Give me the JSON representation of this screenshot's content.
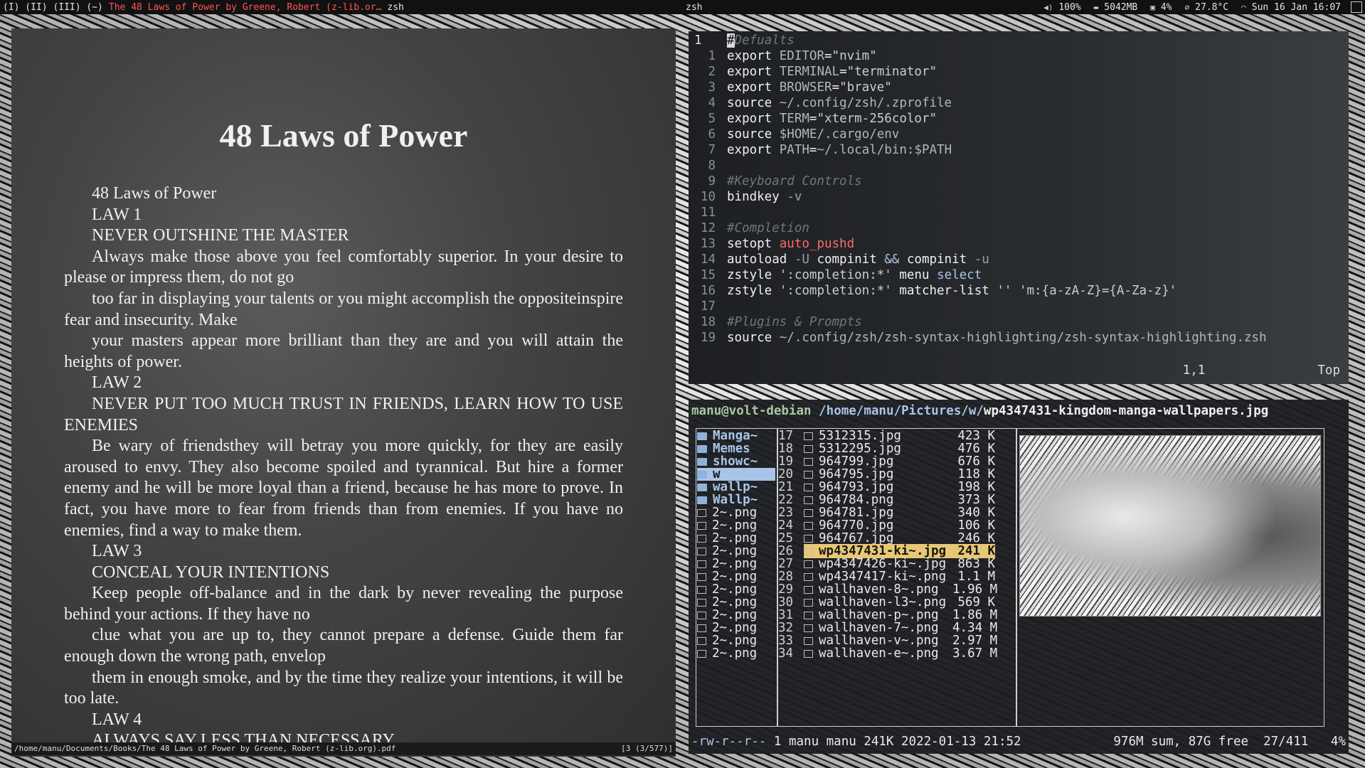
{
  "topbar": {
    "workspaces": "(I) (II) (III) (~)",
    "window_title": "The 48 Laws of Power by Greene, Robert (z-lib.or…",
    "window_class": "zsh",
    "center_title": "zsh",
    "volume": "100%",
    "memory": "5042MB",
    "cpu": "4%",
    "temperature": "27.8°C",
    "datetime": "Sun 16 Jan 16:07",
    "icons": [
      "volume-icon",
      "memory-icon",
      "cpu-icon",
      "temperature-icon",
      "wifi-icon",
      "tray-icon"
    ]
  },
  "pdf": {
    "title": "48 Laws of Power",
    "paragraphs": [
      "48 Laws of Power",
      "LAW 1",
      "NEVER OUTSHINE THE MASTER",
      "Always make those above you feel comfortably superior. In your desire to please or impress them, do not go",
      "too far in displaying your talents or you might accomplish the oppositeinspire fear and insecurity. Make",
      "your masters appear more brilliant than they are and you will attain the heights of power.",
      "LAW 2",
      "NEVER PUT TOO MUCH TRUST IN FRIENDS, LEARN HOW TO USE ENEMIES",
      "Be wary of friendsthey will betray you more quickly, for they are easily aroused to envy. They also become spoiled and tyrannical. But hire a former enemy and he will be more loyal than a friend, because he has more to prove. In fact, you have more to fear from friends than from enemies. If you have no enemies, find a way to make them.",
      "LAW 3",
      "CONCEAL YOUR INTENTIONS",
      "Keep people off-balance and in the dark by never revealing the purpose behind your actions. If they have no",
      "clue what you are up to, they cannot prepare a defense. Guide them far enough down the wrong path, envelop",
      "them in enough smoke, and by the time they realize your intentions, it will be too late.",
      "LAW 4",
      "ALWAYS SAY LESS THAN NECESSARY"
    ],
    "status_path": "/home/manu/Documents/Books/The 48 Laws of Power by Greene, Robert (z-lib.org).pdf",
    "status_page": "[3 (3/577)]"
  },
  "nvim": {
    "lines": [
      {
        "n": "1",
        "segs": [
          [
            "cursor",
            "#"
          ],
          [
            "c-cmt",
            "Defualts"
          ]
        ],
        "current": true
      },
      {
        "n": "1",
        "segs": [
          [
            "c-kw",
            "export "
          ],
          [
            "c-var",
            "EDITOR"
          ],
          [
            "c-kw",
            "="
          ],
          [
            "c-str",
            "\"nvim\""
          ]
        ]
      },
      {
        "n": "2",
        "segs": [
          [
            "c-kw",
            "export "
          ],
          [
            "c-var",
            "TERMINAL"
          ],
          [
            "c-kw",
            "="
          ],
          [
            "c-str",
            "\"terminator\""
          ]
        ]
      },
      {
        "n": "3",
        "segs": [
          [
            "c-kw",
            "export "
          ],
          [
            "c-var",
            "BROWSER"
          ],
          [
            "c-kw",
            "="
          ],
          [
            "c-str",
            "\"brave\""
          ]
        ]
      },
      {
        "n": "4",
        "segs": [
          [
            "c-kw",
            "source "
          ],
          [
            "c-var",
            "~/.config/zsh/.zprofile"
          ]
        ]
      },
      {
        "n": "5",
        "segs": [
          [
            "c-kw",
            "export "
          ],
          [
            "c-var",
            "TERM"
          ],
          [
            "c-kw",
            "="
          ],
          [
            "c-str",
            "\"xterm-256color\""
          ]
        ]
      },
      {
        "n": "6",
        "segs": [
          [
            "c-kw",
            "source "
          ],
          [
            "c-var",
            "$HOME"
          ],
          [
            "c-var",
            "/.cargo/env"
          ]
        ]
      },
      {
        "n": "7",
        "segs": [
          [
            "c-kw",
            "export "
          ],
          [
            "c-var",
            "PATH"
          ],
          [
            "c-kw",
            "="
          ],
          [
            "c-var",
            "~/.local/bin:"
          ],
          [
            "c-var",
            "$PATH"
          ]
        ]
      },
      {
        "n": "8",
        "segs": []
      },
      {
        "n": "9",
        "segs": [
          [
            "c-cmt",
            "#Keyboard Controls"
          ]
        ]
      },
      {
        "n": "10",
        "segs": [
          [
            "c-kw",
            "bindkey "
          ],
          [
            "c-flag",
            "-v"
          ]
        ]
      },
      {
        "n": "11",
        "segs": []
      },
      {
        "n": "12",
        "segs": [
          [
            "c-cmt",
            "#Completion"
          ]
        ]
      },
      {
        "n": "13",
        "segs": [
          [
            "c-kw",
            "setopt "
          ],
          [
            "c-red",
            "auto_pushd"
          ]
        ]
      },
      {
        "n": "14",
        "segs": [
          [
            "c-kw",
            "autoload "
          ],
          [
            "c-flag",
            "-U "
          ],
          [
            "c-kw",
            "compinit "
          ],
          [
            "c-blue",
            "&& "
          ],
          [
            "c-kw",
            "compinit "
          ],
          [
            "c-flag",
            "-u"
          ]
        ]
      },
      {
        "n": "15",
        "segs": [
          [
            "c-kw",
            "zstyle "
          ],
          [
            "c-str",
            "':completion:*' "
          ],
          [
            "c-kw",
            "menu "
          ],
          [
            "c-blue",
            "select"
          ]
        ]
      },
      {
        "n": "16",
        "segs": [
          [
            "c-kw",
            "zstyle "
          ],
          [
            "c-str",
            "':completion:*' "
          ],
          [
            "c-kw",
            "matcher-list "
          ],
          [
            "c-str",
            "'' 'm:{a-zA-Z}={A-Za-z}'"
          ]
        ]
      },
      {
        "n": "17",
        "segs": []
      },
      {
        "n": "18",
        "segs": [
          [
            "c-cmt",
            "#Plugins & Prompts"
          ]
        ]
      },
      {
        "n": "19",
        "segs": [
          [
            "c-kw",
            "source "
          ],
          [
            "c-var",
            "~/.config/zsh/zsh-syntax-highlighting/zsh-syntax-highlighting.zsh"
          ]
        ]
      }
    ],
    "ruler_pos": "1,1",
    "ruler_scroll": "Top"
  },
  "lf": {
    "header_user": "manu@volt-debian",
    "header_path": "/home/manu/Pictures/w/",
    "header_file": "wp4347431-kingdom-manga-wallpapers.jpg",
    "parent_entries": [
      {
        "name": "Manga~",
        "type": "dir"
      },
      {
        "name": "Memes",
        "type": "dir"
      },
      {
        "name": "showc~",
        "type": "dir"
      },
      {
        "name": "w",
        "type": "dir",
        "selected": true
      },
      {
        "name": "wallp~",
        "type": "dir"
      },
      {
        "name": "Wallp~",
        "type": "dir"
      },
      {
        "name": "2~.png",
        "type": "img"
      },
      {
        "name": "2~.png",
        "type": "img"
      },
      {
        "name": "2~.png",
        "type": "img"
      },
      {
        "name": "2~.png",
        "type": "img"
      },
      {
        "name": "2~.png",
        "type": "img"
      },
      {
        "name": "2~.png",
        "type": "img"
      },
      {
        "name": "2~.png",
        "type": "img"
      },
      {
        "name": "2~.png",
        "type": "img"
      },
      {
        "name": "2~.png",
        "type": "img"
      },
      {
        "name": "2~.png",
        "type": "img"
      },
      {
        "name": "2~.png",
        "type": "img"
      },
      {
        "name": "2~.png",
        "type": "img"
      }
    ],
    "files": [
      {
        "num": "17",
        "name": "5312315.jpg",
        "size": "423 K"
      },
      {
        "num": "18",
        "name": "5312295.jpg",
        "size": "476 K"
      },
      {
        "num": "19",
        "name": "964799.jpg",
        "size": "676 K"
      },
      {
        "num": "20",
        "name": "964795.jpg",
        "size": "118 K"
      },
      {
        "num": "21",
        "name": "964793.jpg",
        "size": "198 K"
      },
      {
        "num": "22",
        "name": "964784.png",
        "size": "373 K"
      },
      {
        "num": "23",
        "name": "964781.jpg",
        "size": "340 K"
      },
      {
        "num": "24",
        "name": "964770.jpg",
        "size": "106 K"
      },
      {
        "num": "25",
        "name": "964767.jpg",
        "size": "246 K"
      },
      {
        "num": "26",
        "name": "wp4347431-ki~.jpg",
        "size": "241 K",
        "selected": true
      },
      {
        "num": "27",
        "name": "wp4347426-ki~.jpg",
        "size": "863 K"
      },
      {
        "num": "28",
        "name": "wp4347417-ki~.png",
        "size": "1.1 M"
      },
      {
        "num": "29",
        "name": "wallhaven-8~.png",
        "size": "1.96 M"
      },
      {
        "num": "30",
        "name": "wallhaven-l3~.png",
        "size": "569 K"
      },
      {
        "num": "31",
        "name": "wallhaven-p~.png",
        "size": "1.86 M"
      },
      {
        "num": "32",
        "name": "wallhaven-7~.png",
        "size": "4.34 M"
      },
      {
        "num": "33",
        "name": "wallhaven-v~.png",
        "size": "2.97 M"
      },
      {
        "num": "34",
        "name": "wallhaven-e~.png",
        "size": "3.67 M"
      }
    ],
    "status_perm": "-rw-r--r--",
    "status_info": " 1 manu manu 241K 2022-01-13 21:52",
    "status_right": "976M sum, 87G free  27/411   4%"
  }
}
